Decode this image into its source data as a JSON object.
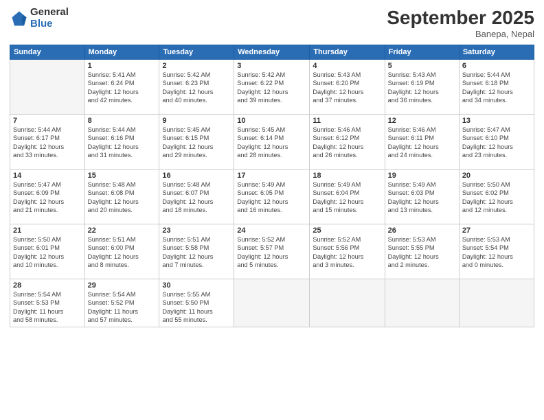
{
  "logo": {
    "general": "General",
    "blue": "Blue"
  },
  "title": "September 2025",
  "subtitle": "Banepa, Nepal",
  "days_header": [
    "Sunday",
    "Monday",
    "Tuesday",
    "Wednesday",
    "Thursday",
    "Friday",
    "Saturday"
  ],
  "weeks": [
    [
      {
        "num": "",
        "info": ""
      },
      {
        "num": "1",
        "info": "Sunrise: 5:41 AM\nSunset: 6:24 PM\nDaylight: 12 hours\nand 42 minutes."
      },
      {
        "num": "2",
        "info": "Sunrise: 5:42 AM\nSunset: 6:23 PM\nDaylight: 12 hours\nand 40 minutes."
      },
      {
        "num": "3",
        "info": "Sunrise: 5:42 AM\nSunset: 6:22 PM\nDaylight: 12 hours\nand 39 minutes."
      },
      {
        "num": "4",
        "info": "Sunrise: 5:43 AM\nSunset: 6:20 PM\nDaylight: 12 hours\nand 37 minutes."
      },
      {
        "num": "5",
        "info": "Sunrise: 5:43 AM\nSunset: 6:19 PM\nDaylight: 12 hours\nand 36 minutes."
      },
      {
        "num": "6",
        "info": "Sunrise: 5:44 AM\nSunset: 6:18 PM\nDaylight: 12 hours\nand 34 minutes."
      }
    ],
    [
      {
        "num": "7",
        "info": "Sunrise: 5:44 AM\nSunset: 6:17 PM\nDaylight: 12 hours\nand 33 minutes."
      },
      {
        "num": "8",
        "info": "Sunrise: 5:44 AM\nSunset: 6:16 PM\nDaylight: 12 hours\nand 31 minutes."
      },
      {
        "num": "9",
        "info": "Sunrise: 5:45 AM\nSunset: 6:15 PM\nDaylight: 12 hours\nand 29 minutes."
      },
      {
        "num": "10",
        "info": "Sunrise: 5:45 AM\nSunset: 6:14 PM\nDaylight: 12 hours\nand 28 minutes."
      },
      {
        "num": "11",
        "info": "Sunrise: 5:46 AM\nSunset: 6:12 PM\nDaylight: 12 hours\nand 26 minutes."
      },
      {
        "num": "12",
        "info": "Sunrise: 5:46 AM\nSunset: 6:11 PM\nDaylight: 12 hours\nand 24 minutes."
      },
      {
        "num": "13",
        "info": "Sunrise: 5:47 AM\nSunset: 6:10 PM\nDaylight: 12 hours\nand 23 minutes."
      }
    ],
    [
      {
        "num": "14",
        "info": "Sunrise: 5:47 AM\nSunset: 6:09 PM\nDaylight: 12 hours\nand 21 minutes."
      },
      {
        "num": "15",
        "info": "Sunrise: 5:48 AM\nSunset: 6:08 PM\nDaylight: 12 hours\nand 20 minutes."
      },
      {
        "num": "16",
        "info": "Sunrise: 5:48 AM\nSunset: 6:07 PM\nDaylight: 12 hours\nand 18 minutes."
      },
      {
        "num": "17",
        "info": "Sunrise: 5:49 AM\nSunset: 6:05 PM\nDaylight: 12 hours\nand 16 minutes."
      },
      {
        "num": "18",
        "info": "Sunrise: 5:49 AM\nSunset: 6:04 PM\nDaylight: 12 hours\nand 15 minutes."
      },
      {
        "num": "19",
        "info": "Sunrise: 5:49 AM\nSunset: 6:03 PM\nDaylight: 12 hours\nand 13 minutes."
      },
      {
        "num": "20",
        "info": "Sunrise: 5:50 AM\nSunset: 6:02 PM\nDaylight: 12 hours\nand 12 minutes."
      }
    ],
    [
      {
        "num": "21",
        "info": "Sunrise: 5:50 AM\nSunset: 6:01 PM\nDaylight: 12 hours\nand 10 minutes."
      },
      {
        "num": "22",
        "info": "Sunrise: 5:51 AM\nSunset: 6:00 PM\nDaylight: 12 hours\nand 8 minutes."
      },
      {
        "num": "23",
        "info": "Sunrise: 5:51 AM\nSunset: 5:58 PM\nDaylight: 12 hours\nand 7 minutes."
      },
      {
        "num": "24",
        "info": "Sunrise: 5:52 AM\nSunset: 5:57 PM\nDaylight: 12 hours\nand 5 minutes."
      },
      {
        "num": "25",
        "info": "Sunrise: 5:52 AM\nSunset: 5:56 PM\nDaylight: 12 hours\nand 3 minutes."
      },
      {
        "num": "26",
        "info": "Sunrise: 5:53 AM\nSunset: 5:55 PM\nDaylight: 12 hours\nand 2 minutes."
      },
      {
        "num": "27",
        "info": "Sunrise: 5:53 AM\nSunset: 5:54 PM\nDaylight: 12 hours\nand 0 minutes."
      }
    ],
    [
      {
        "num": "28",
        "info": "Sunrise: 5:54 AM\nSunset: 5:53 PM\nDaylight: 11 hours\nand 58 minutes."
      },
      {
        "num": "29",
        "info": "Sunrise: 5:54 AM\nSunset: 5:52 PM\nDaylight: 11 hours\nand 57 minutes."
      },
      {
        "num": "30",
        "info": "Sunrise: 5:55 AM\nSunset: 5:50 PM\nDaylight: 11 hours\nand 55 minutes."
      },
      {
        "num": "",
        "info": ""
      },
      {
        "num": "",
        "info": ""
      },
      {
        "num": "",
        "info": ""
      },
      {
        "num": "",
        "info": ""
      }
    ]
  ]
}
